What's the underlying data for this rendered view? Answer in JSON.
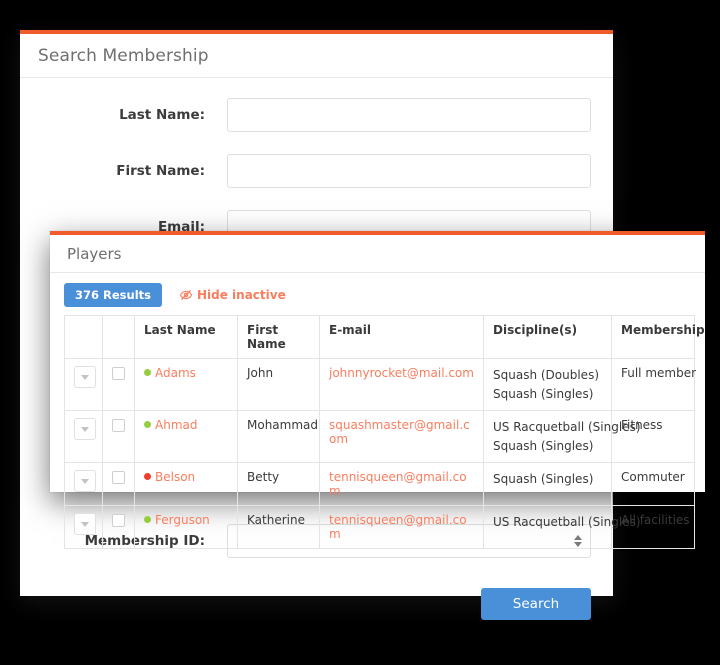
{
  "theme": {
    "accent_orange": "#f15b2b",
    "link_salmon": "#fa7d5e",
    "primary_blue": "#4a90d9",
    "status_active": "#96cc3f",
    "status_inactive": "#ec3f2c",
    "page_background": "#000000"
  },
  "search_panel": {
    "title": "Search Membership",
    "fields": [
      {
        "label": "Last Name:",
        "value": "",
        "placeholder": "",
        "type": "text"
      },
      {
        "label": "First Name:",
        "value": "",
        "placeholder": "",
        "type": "text"
      },
      {
        "label": "Email:",
        "value": "",
        "placeholder": "",
        "type": "text"
      },
      {
        "label": "Membership ID:",
        "value": "",
        "placeholder": "",
        "type": "number"
      }
    ],
    "submit_label": "Search"
  },
  "players_panel": {
    "title": "Players",
    "results_badge": "376 Results",
    "hide_inactive_label": "Hide inactive",
    "hide_inactive_icon": "eye-slash-icon",
    "table": {
      "columns": [
        "",
        "",
        "Last Name",
        "First Name",
        "E-mail",
        "Discipline(s)",
        "Membership"
      ],
      "rows": [
        {
          "status": "active",
          "last_name": "Adams",
          "first_name": "John",
          "email": "johnnyrocket@mail.com",
          "disciplines": [
            "Squash (Doubles)",
            "Squash (Singles)"
          ],
          "membership": "Full member",
          "checked": false
        },
        {
          "status": "active",
          "last_name": "Ahmad",
          "first_name": "Mohammad",
          "email": "squashmaster@gmail.com",
          "disciplines": [
            "US Racquetball (Singles)",
            "Squash (Singles)"
          ],
          "membership": "Fitness",
          "checked": false
        },
        {
          "status": "inactive",
          "last_name": "Belson",
          "first_name": "Betty",
          "email": "tennisqueen@gmail.com",
          "disciplines": [
            "Squash (Singles)"
          ],
          "membership": "Commuter",
          "checked": false
        },
        {
          "status": "active",
          "last_name": "Ferguson",
          "first_name": "Katherine",
          "email": "tennisqueen@gmail.com",
          "disciplines": [
            "US Racquetball (Singles)"
          ],
          "membership": "All facilities",
          "checked": false
        }
      ]
    }
  }
}
